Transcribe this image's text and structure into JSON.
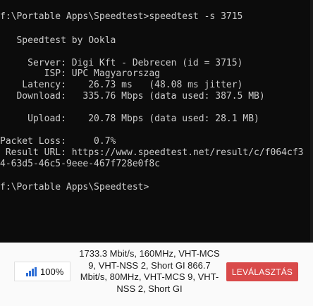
{
  "terminal": {
    "prompt1": "f:\\Portable Apps\\Speedtest>speedtest -s 3715",
    "title": "   Speedtest by Ookla",
    "server": "     Server: Digi Kft - Debrecen (id = 3715)",
    "isp": "        ISP: UPC Magyarorszag",
    "latency": "    Latency:    26.73 ms   (48.08 ms jitter)",
    "download": "   Download:   335.76 Mbps (data used: 387.5 MB)",
    "upload": "     Upload:    20.78 Mbps (data used: 28.1 MB)",
    "packet_loss": "Packet Loss:     0.7%",
    "result_url": " Result URL: https://www.speedtest.net/result/c/f064cf3",
    "result_url_cont": "4-63d5-46c5-9eee-467f728e0f8c",
    "prompt2": "f:\\Portable Apps\\Speedtest>"
  },
  "status_bar": {
    "signal_value": "100%",
    "link_info": "1733.3 Mbit/s, 160MHz, VHT-MCS 9, VHT-NSS 2, Short GI 866.7 Mbit/s, 80MHz, VHT-MCS 9, VHT-NSS 2, Short GI",
    "disconnect_label": "LEVÁLASZTÁS",
    "accent_color": "#d94a4a",
    "signal_color": "#2f6fd6"
  }
}
